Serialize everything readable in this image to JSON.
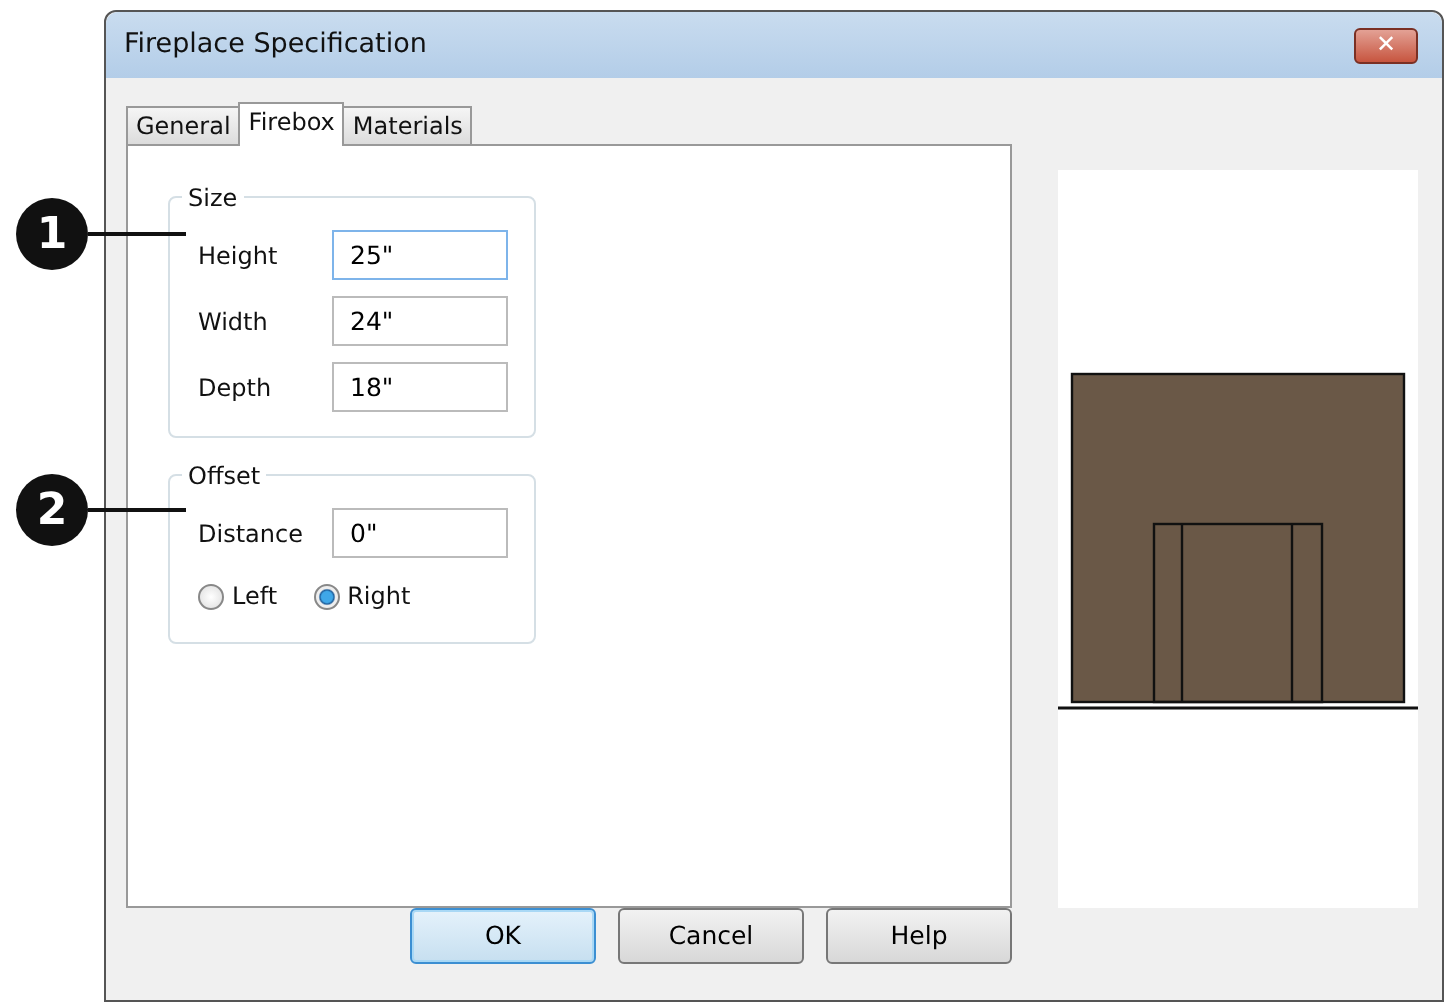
{
  "window": {
    "title": "Fireplace Specification",
    "close": "✕"
  },
  "tabs": [
    {
      "label": "General",
      "selected": false
    },
    {
      "label": "Firebox",
      "selected": true
    },
    {
      "label": "Materials",
      "selected": false
    }
  ],
  "groups": [
    {
      "title": "Size",
      "callout": "1",
      "fields": [
        {
          "label": "Height",
          "value": "25\"",
          "focused": true
        },
        {
          "label": "Width",
          "value": "24\"",
          "focused": false
        },
        {
          "label": "Depth",
          "value": "18\"",
          "focused": false
        }
      ]
    },
    {
      "title": "Offset",
      "callout": "2",
      "fields": [
        {
          "label": "Distance",
          "value": "0\"",
          "focused": false
        }
      ],
      "radios": [
        {
          "label": "Left",
          "selected": false
        },
        {
          "label": "Right",
          "selected": true
        }
      ]
    }
  ],
  "buttons": [
    {
      "label": "OK",
      "default": true
    },
    {
      "label": "Cancel",
      "default": false
    },
    {
      "label": "Help",
      "default": false
    }
  ]
}
